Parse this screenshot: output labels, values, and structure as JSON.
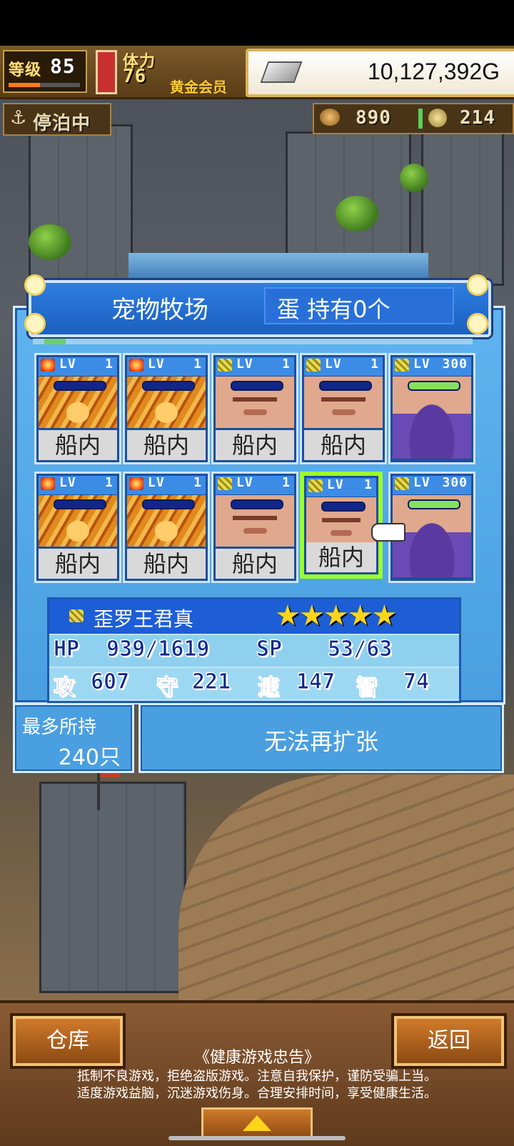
{
  "hud": {
    "level_label": "等级",
    "level_value": "85",
    "stamina_label": "体力",
    "stamina_value": "76",
    "membership": "黄金会员",
    "gold": "10,127,392G",
    "status": "停泊中",
    "resource1": "890",
    "resource2": "214"
  },
  "panel": {
    "title": "宠物牧场",
    "eggs": "蛋 持有0个",
    "cells": [
      {
        "element": "fire",
        "lv_label": "LV",
        "lv": "1",
        "art": "dragon",
        "location": "船内",
        "selected": false,
        "bar_full": false
      },
      {
        "element": "fire",
        "lv_label": "LV",
        "lv": "1",
        "art": "dragon",
        "location": "船内",
        "selected": false,
        "bar_full": false
      },
      {
        "element": "earth",
        "lv_label": "LV",
        "lv": "1",
        "art": "face",
        "location": "船内",
        "selected": false,
        "bar_full": false
      },
      {
        "element": "earth",
        "lv_label": "LV",
        "lv": "1",
        "art": "face",
        "location": "船内",
        "selected": false,
        "bar_full": false
      },
      {
        "element": "earth",
        "lv_label": "LV",
        "lv": "300",
        "art": "knight",
        "location": "",
        "selected": false,
        "bar_full": true
      },
      {
        "element": "fire",
        "lv_label": "LV",
        "lv": "1",
        "art": "dragon",
        "location": "船内",
        "selected": false,
        "bar_full": false
      },
      {
        "element": "fire",
        "lv_label": "LV",
        "lv": "1",
        "art": "dragon",
        "location": "船内",
        "selected": false,
        "bar_full": false
      },
      {
        "element": "earth",
        "lv_label": "LV",
        "lv": "1",
        "art": "face",
        "location": "船内",
        "selected": false,
        "bar_full": false
      },
      {
        "element": "earth",
        "lv_label": "LV",
        "lv": "1",
        "art": "face",
        "location": "船内",
        "selected": true,
        "bar_full": false
      },
      {
        "element": "earth",
        "lv_label": "LV",
        "lv": "300",
        "art": "knight",
        "location": "",
        "selected": false,
        "bar_full": true
      }
    ],
    "selected_name": "歪罗王君真",
    "stars": 5,
    "hp_label": "HP",
    "hp": "939/1619",
    "sp_label": "SP",
    "sp": "53/63",
    "atk_label": "攻",
    "atk": "607",
    "def_label": "守",
    "def": "221",
    "spd_label": "速",
    "spd": "147",
    "int_label": "智",
    "int": "74",
    "max_label": "最多所持",
    "max_value": "240只",
    "expand_label": "无法再扩张"
  },
  "footer": {
    "left_button": "仓库",
    "right_button": "返回",
    "notice_title": "《健康游戏忠告》",
    "notice_line1": "抵制不良游戏，拒绝盗版游戏。注意自我保护，谨防受骗上当。",
    "notice_line2": "适度游戏益脑，沉迷游戏伤身。合理安排时间，享受健康生活。"
  }
}
